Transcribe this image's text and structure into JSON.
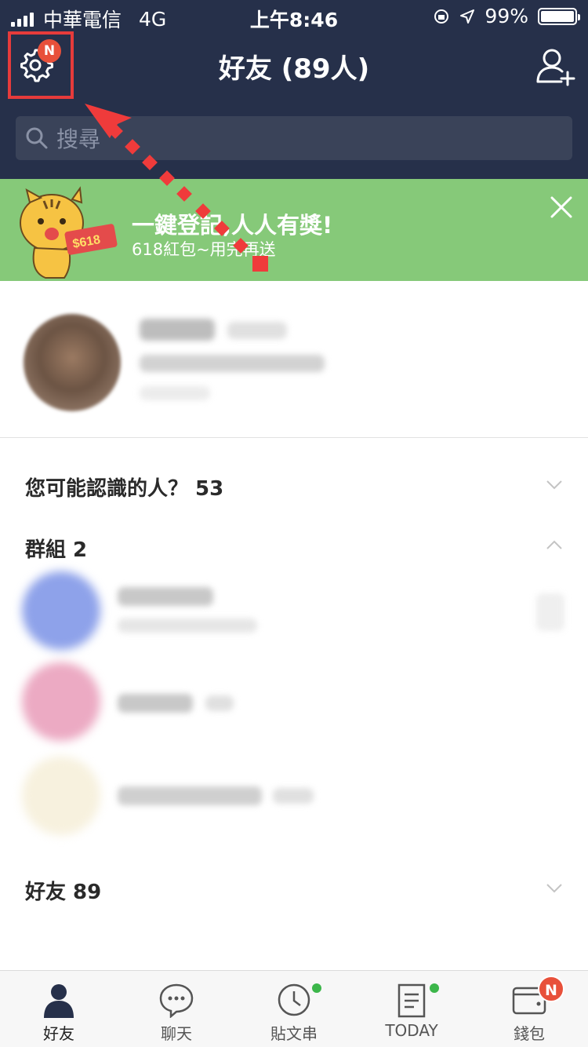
{
  "status": {
    "carrier": "中華電信",
    "network": "4G",
    "time": "上午8:46",
    "battery": "99%"
  },
  "header": {
    "title": "好友 (89人)",
    "settings_badge": "N",
    "search_placeholder": "搜尋"
  },
  "banner": {
    "headline": "一鍵登記,人人有獎!",
    "sub": "618紅包~用完再送",
    "tag": "$618"
  },
  "sections": {
    "suggest": "您可能認識的人？ 53",
    "groups": "群組 2",
    "friends": "好友 89"
  },
  "tabs": [
    {
      "label": "好友"
    },
    {
      "label": "聊天"
    },
    {
      "label": "貼文串"
    },
    {
      "label": "TODAY"
    },
    {
      "label": "錢包",
      "badge": "N"
    }
  ],
  "colors": {
    "header_bg": "#26304a",
    "banner_bg": "#86c979",
    "highlight": "#e63b3b",
    "badge": "#e8503a"
  }
}
